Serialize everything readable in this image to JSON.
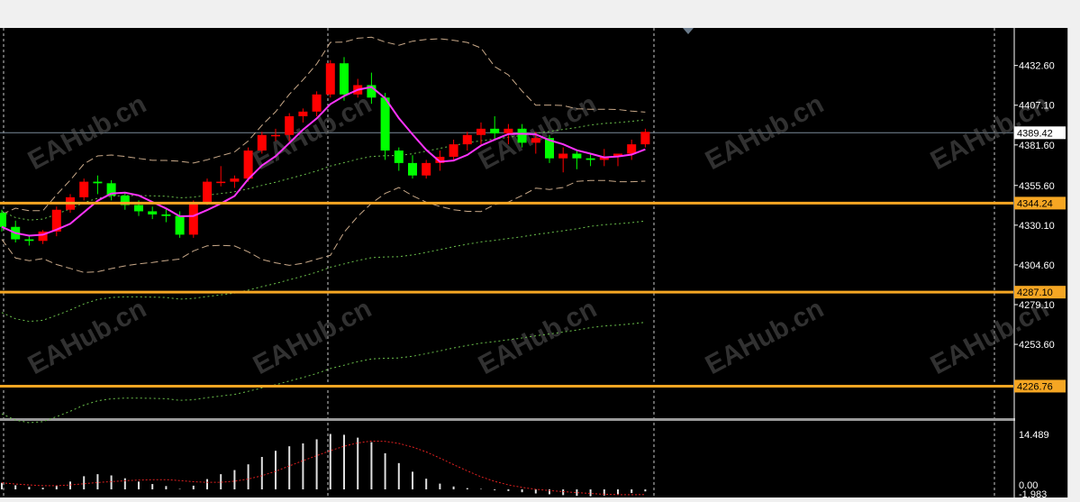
{
  "price_scale": {
    "ticks": [
      "4432.60",
      "4407.10",
      "4381.60",
      "4355.60",
      "4330.10",
      "4304.60",
      "4279.10",
      "4253.60"
    ],
    "current_price": "4389.42",
    "levels": [
      "4344.24",
      "4287.10",
      "4226.76"
    ]
  },
  "indicator_scale": {
    "max_label": "14.489",
    "zero_label": "0.00",
    "min_label": "-1.983"
  },
  "watermark": "EAHub.cn",
  "colors": {
    "background": "#000000",
    "bull": "#00ff00",
    "bear": "#ff0000",
    "level_line": "#f5a623",
    "ma": "#ff33ff",
    "bands": "#c8a888",
    "envelope": "#6abf4b"
  },
  "chart_data": [
    {
      "type": "candlestick",
      "series": [
        {
          "values": [
            [
              4338,
              4340,
              4326,
              4329
            ],
            [
              4329,
              4333,
              4319,
              4321
            ],
            [
              4321,
              4323,
              4317,
              4320
            ],
            [
              4320,
              4327,
              4318,
              4326
            ],
            [
              4326,
              4342,
              4323,
              4340
            ],
            [
              4340,
              4350,
              4338,
              4348
            ],
            [
              4348,
              4360,
              4346,
              4358
            ],
            [
              4358,
              4362,
              4350,
              4357
            ],
            [
              4357,
              4359,
              4346,
              4349
            ],
            [
              4349,
              4351,
              4340,
              4343
            ],
            [
              4343,
              4346,
              4336,
              4339
            ],
            [
              4339,
              4342,
              4334,
              4337
            ],
            [
              4337,
              4341,
              4332,
              4336
            ],
            [
              4336,
              4339,
              4322,
              4324
            ],
            [
              4324,
              4346,
              4322,
              4344
            ],
            [
              4344,
              4360,
              4343,
              4358
            ],
            [
              4358,
              4368,
              4355,
              4358
            ],
            [
              4358,
              4362,
              4354,
              4360
            ],
            [
              4360,
              4380,
              4358,
              4378
            ],
            [
              4378,
              4390,
              4376,
              4388
            ],
            [
              4388,
              4392,
              4384,
              4388
            ],
            [
              4388,
              4402,
              4384,
              4400
            ],
            [
              4400,
              4405,
              4396,
              4403
            ],
            [
              4403,
              4416,
              4400,
              4414
            ],
            [
              4414,
              4436,
              4412,
              4434
            ],
            [
              4434,
              4438,
              4410,
              4414
            ],
            [
              4414,
              4424,
              4412,
              4420
            ],
            [
              4420,
              4428,
              4408,
              4412
            ],
            [
              4412,
              4415,
              4372,
              4378
            ],
            [
              4378,
              4380,
              4365,
              4370
            ],
            [
              4370,
              4375,
              4360,
              4362
            ],
            [
              4362,
              4372,
              4360,
              4370
            ],
            [
              4370,
              4378,
              4365,
              4374
            ],
            [
              4374,
              4385,
              4372,
              4382
            ],
            [
              4382,
              4390,
              4378,
              4388
            ],
            [
              4388,
              4396,
              4382,
              4392
            ],
            [
              4392,
              4400,
              4385,
              4389
            ],
            [
              4389,
              4395,
              4382,
              4392
            ],
            [
              4392,
              4395,
              4380,
              4383
            ],
            [
              4383,
              4390,
              4376,
              4386
            ],
            [
              4386,
              4388,
              4370,
              4373
            ],
            [
              4373,
              4380,
              4364,
              4376
            ],
            [
              4376,
              4378,
              4366,
              4373
            ],
            [
              4373,
              4376,
              4368,
              4372
            ],
            [
              4372,
              4379,
              4368,
              4374
            ],
            [
              4374,
              4376,
              4368,
              4376
            ],
            [
              4376,
              4385,
              4372,
              4382
            ],
            [
              4382,
              4392,
              4380,
              4390
            ]
          ]
        }
      ],
      "ylim": [
        4206.2,
        4456.7
      ]
    },
    {
      "type": "bar",
      "values": [
        1.6,
        1.0,
        0.6,
        0.4,
        0.9,
        1.9,
        3.2,
        3.7,
        3.4,
        2.7,
        1.9,
        1.3,
        0.8,
        0.1,
        0.9,
        2.5,
        3.7,
        4.7,
        6.1,
        7.9,
        9.4,
        10.5,
        11.2,
        12.2,
        13.5,
        13.3,
        12.6,
        11.5,
        8.8,
        6.4,
        4.3,
        2.6,
        1.4,
        0.7,
        0.3,
        0.1,
        -0.2,
        -0.4,
        -0.7,
        -1.0,
        -1.2,
        -1.4,
        -1.6,
        -1.7,
        -1.5,
        -1.2,
        -0.9,
        -0.5
      ],
      "ylim": [
        -1.983,
        14.489
      ]
    }
  ]
}
